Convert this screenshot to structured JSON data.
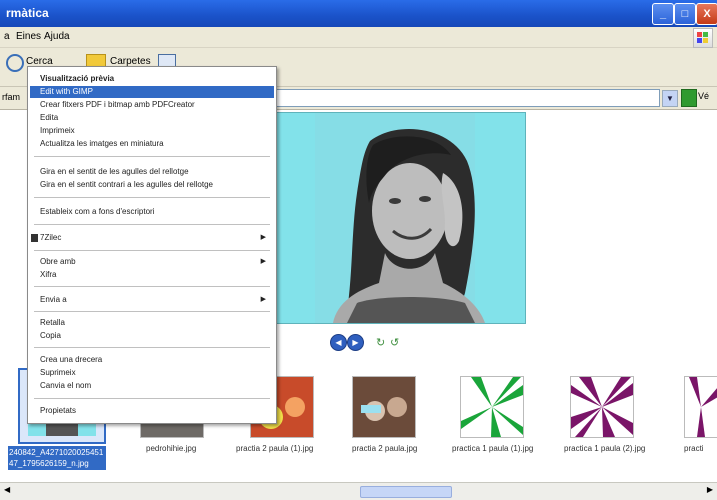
{
  "window": {
    "title": "rmàtica",
    "minimize": "_",
    "maximize": "□",
    "close": "X"
  },
  "menubar": {
    "items": [
      "a",
      "Eines",
      "Ajuda"
    ]
  },
  "toolbar": {
    "search_label": "Cerca",
    "folders_label": "Carpetes"
  },
  "address": {
    "left_label": "rfam",
    "go_label": "Vé"
  },
  "context_menu": {
    "items": [
      "Visualització prèvia",
      "Edit with GIMP",
      "Crear fitxers PDF i bitmap amb PDFCreator",
      "Edita",
      "Imprimeix",
      "Actualitza les imatges en miniatura",
      "Gira en el sentit de les agulles del rellotge",
      "Gira en el sentit contrari a les agulles del rellotge",
      "Estableix com a fons d'escriptori",
      "7Zilec",
      "Obre amb",
      "Xifra",
      "Envia a",
      "Retalla",
      "Copia",
      "Crea una drecera",
      "Suprimeix",
      "Canvia el nom",
      "Propietats"
    ]
  },
  "thumbnails": [
    {
      "caption": "240842_A4271020025451 47_1795626159_n.jpg"
    },
    {
      "caption": "pedrohihie.jpg"
    },
    {
      "caption": "practia 2 paula (1).jpg"
    },
    {
      "caption": "practia 2 paula.jpg"
    },
    {
      "caption": "practica 1 paula (1).jpg"
    },
    {
      "caption": "practica 1 paula (2).jpg"
    },
    {
      "caption": "practi"
    }
  ],
  "colors": {
    "title_blue": "#1a52c9",
    "highlight": "#316ac5",
    "preview_bg": "#82e2ea"
  }
}
